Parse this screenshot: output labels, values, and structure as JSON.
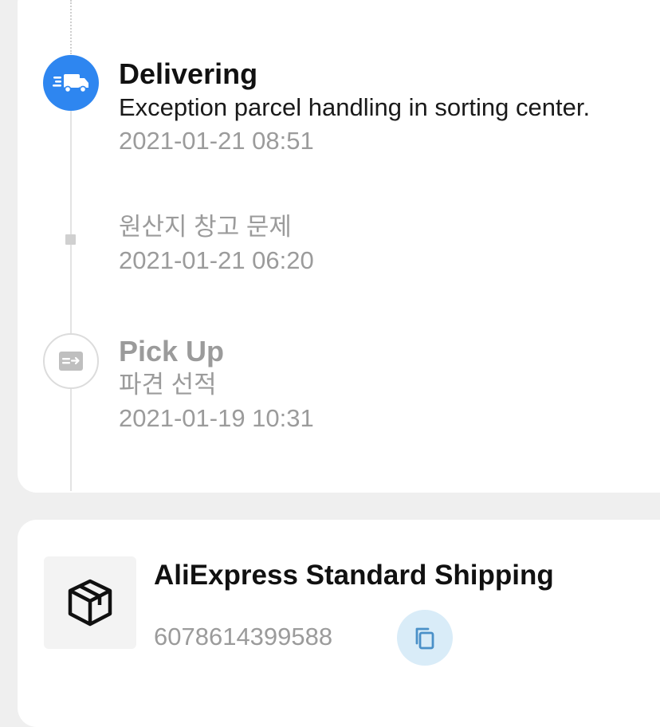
{
  "timeline": {
    "events": [
      {
        "title": "Delivering",
        "description": "Exception parcel handling in sorting center.",
        "time": "2021-01-21 08:51",
        "icon": "delivery-truck-icon",
        "state": "active"
      },
      {
        "description": "원산지 창고 문제",
        "time": "2021-01-21 06:20",
        "state": "muted"
      },
      {
        "title": "Pick Up",
        "description": "파견 선적",
        "time": "2021-01-19 10:31",
        "icon": "pickup-box-icon",
        "state": "muted"
      }
    ]
  },
  "carrier": {
    "name": "AliExpress Standard Shipping",
    "tracking_number": "6078614399588",
    "logo_icon": "package-box-icon",
    "copy_icon": "copy-icon"
  },
  "colors": {
    "accent": "#2e86f0",
    "muted_text": "#9b9b9b",
    "copy_button_bg": "#d9ecf8",
    "copy_icon": "#4a90c8",
    "page_bg": "#efefef"
  }
}
